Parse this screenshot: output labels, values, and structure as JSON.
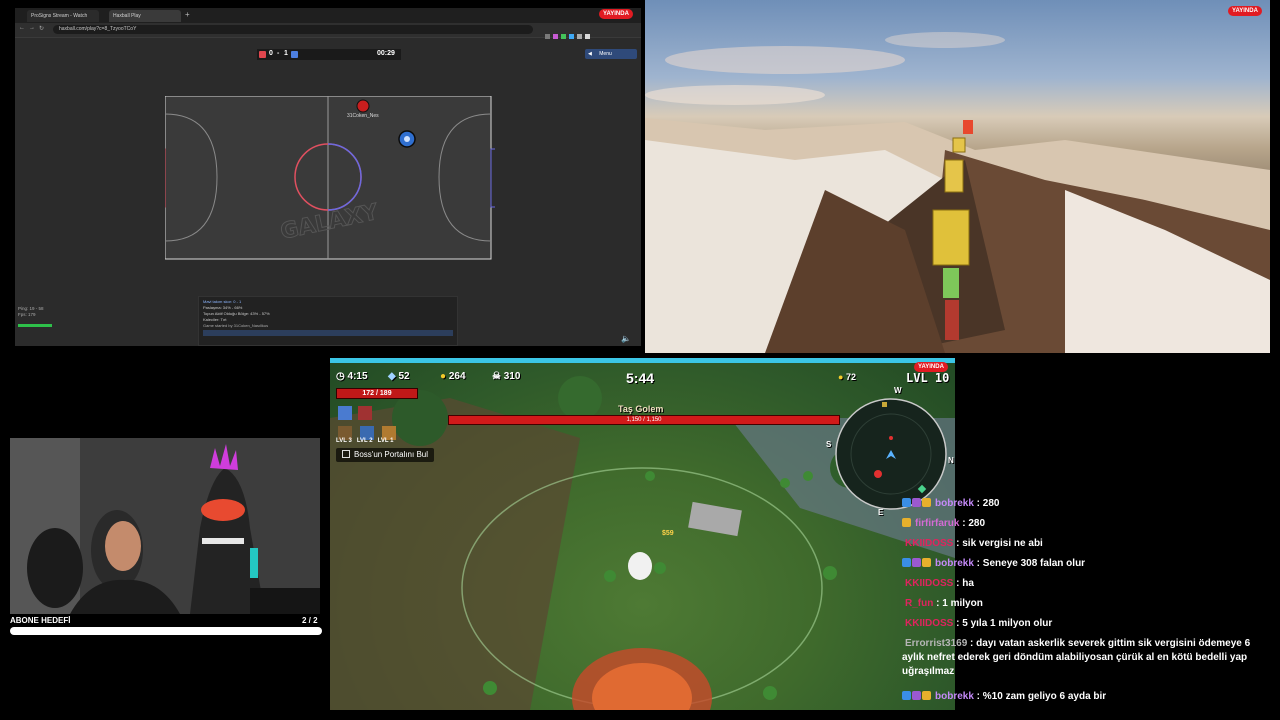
{
  "browser": {
    "tabs": [
      "ProSigns Stream - Watch Live",
      "Haxball Play"
    ],
    "url": "haxball.com/play?c=8_TzyooTCoY",
    "live_badge": "YAYINDA",
    "menu_button": "Menu",
    "score_left": "0",
    "score_sep": "-",
    "score_right": "1",
    "timer": "00:29",
    "player_name": "31Coken_Nes",
    "field_logo": "GALAXY",
    "ping": "Ping: 19 - 58",
    "fps": "Fps: 179",
    "chat_lines": [
      "Mavi takım skor: 0 - 1",
      "Paslaşma: 34% - 66%",
      "Topun Aktif Olduğu Bölge: 43% - 57%",
      "Kaleciler: Tırt",
      "Game started by 31Coken_Nasıllkus"
    ]
  },
  "mc": {
    "live_badge": "YAYINDA"
  },
  "game": {
    "live_badge": "YAYINDA",
    "timer_small": "4:15",
    "stat_a": "52",
    "stat_b": "264",
    "stat_c": "310",
    "main_timer": "5:44",
    "coins": "72",
    "level": "LVL 10",
    "hp": "172 / 189",
    "boss_name": "Taş Golem",
    "boss_hp": "1,150 / 1,150",
    "quest": "Boss'un Portalını Bul",
    "skill_levels": [
      "LVL 3",
      "LVL 2",
      "LVL 1"
    ],
    "gold_popup": "$59",
    "compass": {
      "n": "N",
      "s": "S",
      "e": "E",
      "w": "W"
    }
  },
  "cam": {
    "goal_label": "ABONE HEDEFİ",
    "goal_count": "2 / 2",
    "goal_progress": 1.0
  },
  "chat": [
    {
      "user": "bobrekk",
      "color": "#c58af9",
      "text": ": 280"
    },
    {
      "user": "firfirfaruk",
      "color": "#d46bd4",
      "text": ": 280"
    },
    {
      "user": "KKIIDOSS",
      "color": "#e0245e",
      "text": ": sik vergisi ne abi"
    },
    {
      "user": "bobrekk",
      "color": "#c58af9",
      "text": ": Seneye 308 falan olur"
    },
    {
      "user": "KKIIDOSS",
      "color": "#e0245e",
      "text": ": ha"
    },
    {
      "user": "R_fun",
      "color": "#e0245e",
      "text": ": 1 milyon"
    },
    {
      "user": "KKIIDOSS",
      "color": "#e0245e",
      "text": ": 5 yıla 1 milyon olur"
    },
    {
      "user": "Errorrist3169",
      "color": "#b6b6b6",
      "text": ": dayı vatan askerlik severek gittim sik vergisini ödemeye 6 aylık nefret ederek geri döndüm alabiliyosan çürük al en kötü bedelli yap uğraşılmaz"
    },
    {
      "user": "bobrekk",
      "color": "#c58af9",
      "text": ": %10 zam geliyo 6 ayda bir"
    }
  ]
}
